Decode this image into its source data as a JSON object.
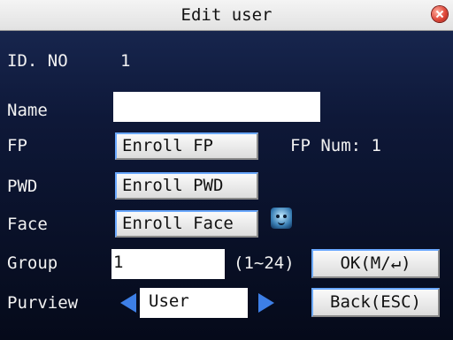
{
  "window": {
    "title": "Edit user"
  },
  "labels": {
    "id_no": "ID. NO",
    "name": "Name",
    "fp": "FP",
    "pwd": "PWD",
    "face": "Face",
    "group": "Group",
    "purview": "Purview"
  },
  "values": {
    "id_no": "1",
    "name": "",
    "fp_num_label": "FP Num: 1",
    "group": "1",
    "group_range": "(1~24)",
    "purview": "User"
  },
  "buttons": {
    "enroll_fp": "Enroll FP",
    "enroll_pwd": "Enroll PWD",
    "enroll_face": "Enroll Face",
    "ok": "OK(M/↵)",
    "back": "Back(ESC)"
  },
  "icons": {
    "close": "close-icon",
    "face": "face-icon",
    "left": "arrow-left-icon",
    "right": "arrow-right-icon"
  },
  "colors": {
    "titlebar": "#e8e8e8",
    "arrow": "#3d7fe6",
    "close": "#e0483a"
  }
}
